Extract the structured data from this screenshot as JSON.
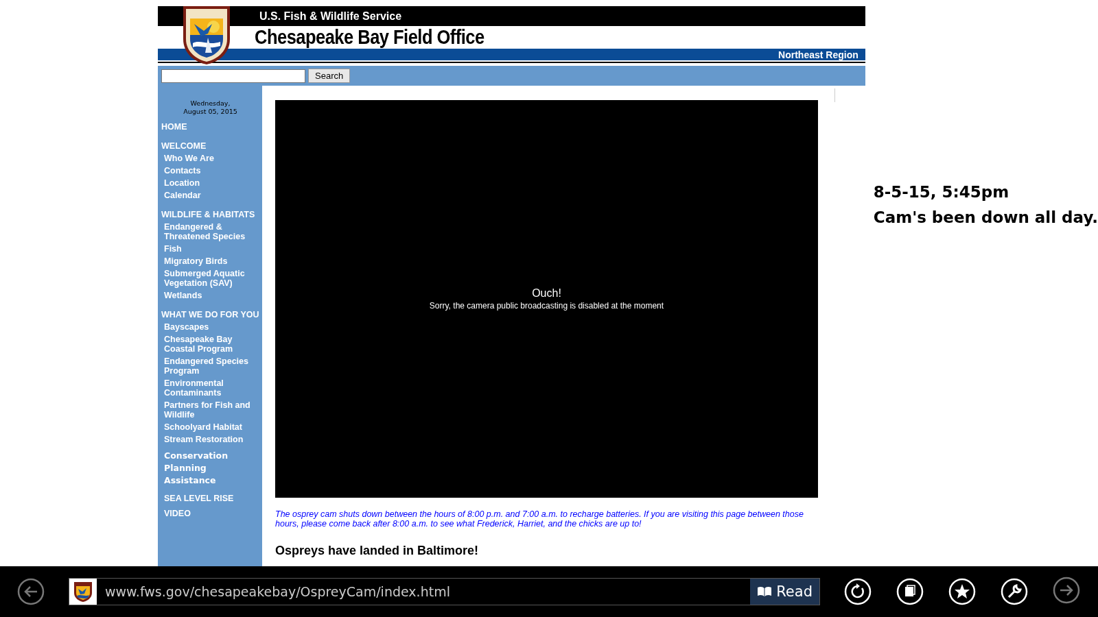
{
  "header": {
    "agency": "U.S. Fish & Wildlife Service",
    "office": "Chesapeake Bay Field Office",
    "region": "Northeast Region"
  },
  "search": {
    "button": "Search"
  },
  "sidebar": {
    "date": "Wednesday,\nAugust 05, 2015",
    "items": [
      {
        "kind": "section",
        "label": "HOME"
      },
      {
        "kind": "section",
        "label": "WELCOME"
      },
      {
        "kind": "link",
        "label": "Who We Are"
      },
      {
        "kind": "link",
        "label": "Contacts"
      },
      {
        "kind": "link",
        "label": "Location"
      },
      {
        "kind": "link",
        "label": "Calendar"
      },
      {
        "kind": "section",
        "label": "WILDLIFE & HABITATS"
      },
      {
        "kind": "link",
        "label": "Endangered & Threatened Species"
      },
      {
        "kind": "link",
        "label": "Fish"
      },
      {
        "kind": "link",
        "label": "Migratory Birds"
      },
      {
        "kind": "link",
        "label": "Submerged Aquatic Vegetation (SAV)"
      },
      {
        "kind": "link",
        "label": "Wetlands"
      },
      {
        "kind": "section",
        "label": "WHAT WE DO FOR YOU"
      },
      {
        "kind": "link",
        "label": "Bayscapes"
      },
      {
        "kind": "link",
        "label": "Chesapeake Bay Coastal Program"
      },
      {
        "kind": "link",
        "label": "Endangered Species Program"
      },
      {
        "kind": "link",
        "label": "Environmental Contaminants"
      },
      {
        "kind": "link",
        "label": "Partners for Fish and Wildlife"
      },
      {
        "kind": "link",
        "label": "Schoolyard Habitat"
      },
      {
        "kind": "link",
        "label": "Stream Restoration"
      },
      {
        "kind": "strong",
        "label": "Conservation Planning Assistance"
      },
      {
        "kind": "caps",
        "label": "SEA LEVEL RISE"
      },
      {
        "kind": "caps",
        "label": "VIDEO"
      }
    ]
  },
  "camera": {
    "title": "Ouch!",
    "message": "Sorry, the camera public broadcasting is disabled at the moment"
  },
  "notice": "The osprey cam shuts down between the hours of 8:00 p.m. and 7:00 a.m. to recharge batteries. If you are visiting this page between those hours, please come back after 8:00 a.m. to see what Frederick, Harriet, and the chicks are up to!",
  "heading": "Ospreys have landed in Baltimore!",
  "annotation": [
    "8-5-15, 5:45pm",
    "Cam's been down all day."
  ],
  "browser": {
    "url": "www.fws.gov/chesapeakebay/OspreyCam/index.html",
    "read_button": "Read"
  }
}
